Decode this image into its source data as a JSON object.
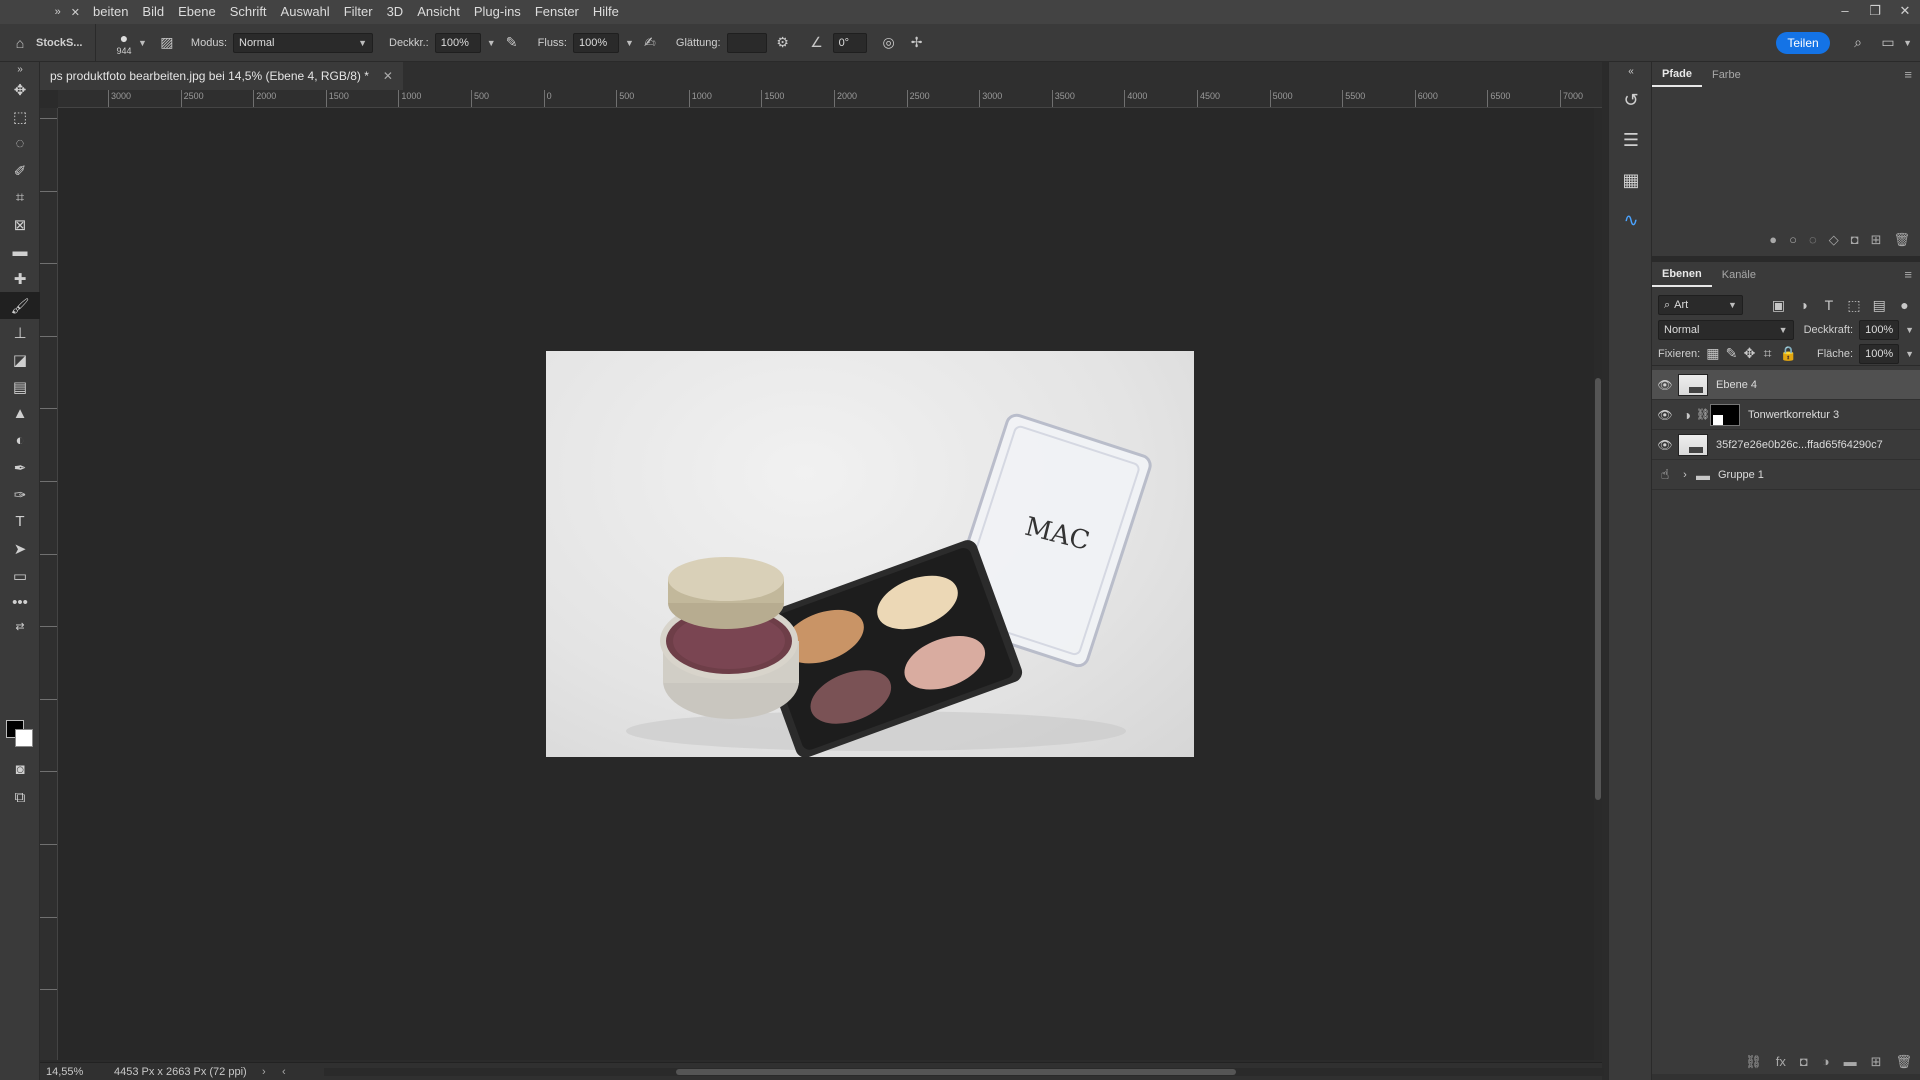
{
  "menubar": {
    "items": [
      "beiten",
      "Bild",
      "Ebene",
      "Schrift",
      "Auswahl",
      "Filter",
      "3D",
      "Ansicht",
      "Plug-ins",
      "Fenster",
      "Hilfe"
    ]
  },
  "options": {
    "workspace_label": "StockS...",
    "brush_size": "944",
    "mode_label": "Modus:",
    "mode_value": "Normal",
    "opacity_label": "Deckkr.:",
    "opacity_value": "100%",
    "flow_label": "Fluss:",
    "flow_value": "100%",
    "smoothing_label": "Glättung:",
    "smoothing_value": "",
    "angle_value": "0°",
    "share_label": "Teilen"
  },
  "document": {
    "tab_title": "ps produktfoto bearbeiten.jpg bei 14,5% (Ebene 4, RGB/8) *",
    "zoom": "14,55%",
    "dimensions": "4453 Px x 2663 Px (72 ppi)"
  },
  "ruler_h": [
    "3000",
    "2500",
    "2000",
    "1500",
    "1000",
    "500",
    "0",
    "500",
    "1000",
    "1500",
    "2000",
    "2500",
    "3000",
    "3500",
    "4000",
    "4500",
    "5000",
    "5500",
    "6000",
    "6500",
    "7000"
  ],
  "paths_panel": {
    "tabs": [
      "Pfade",
      "Farbe"
    ]
  },
  "layers_panel": {
    "tabs": [
      "Ebenen",
      "Kanäle"
    ],
    "filter_value": "Art",
    "blend_value": "Normal",
    "opacity_label": "Deckkraft:",
    "opacity_value": "100%",
    "lock_label": "Fixieren:",
    "fill_label": "Fläche:",
    "fill_value": "100%",
    "layers": [
      {
        "name": "Ebene 4",
        "type": "pixel"
      },
      {
        "name": "Tonwertkorrektur 3",
        "type": "adjustment"
      },
      {
        "name": "35f27e26e0b26c...ffad65f64290c7",
        "type": "pixel"
      },
      {
        "name": "Gruppe 1",
        "type": "group"
      }
    ]
  },
  "colors": {
    "accent": "#1473e6",
    "panel_bg": "#3a3a3a",
    "canvas_bg": "#282828"
  }
}
